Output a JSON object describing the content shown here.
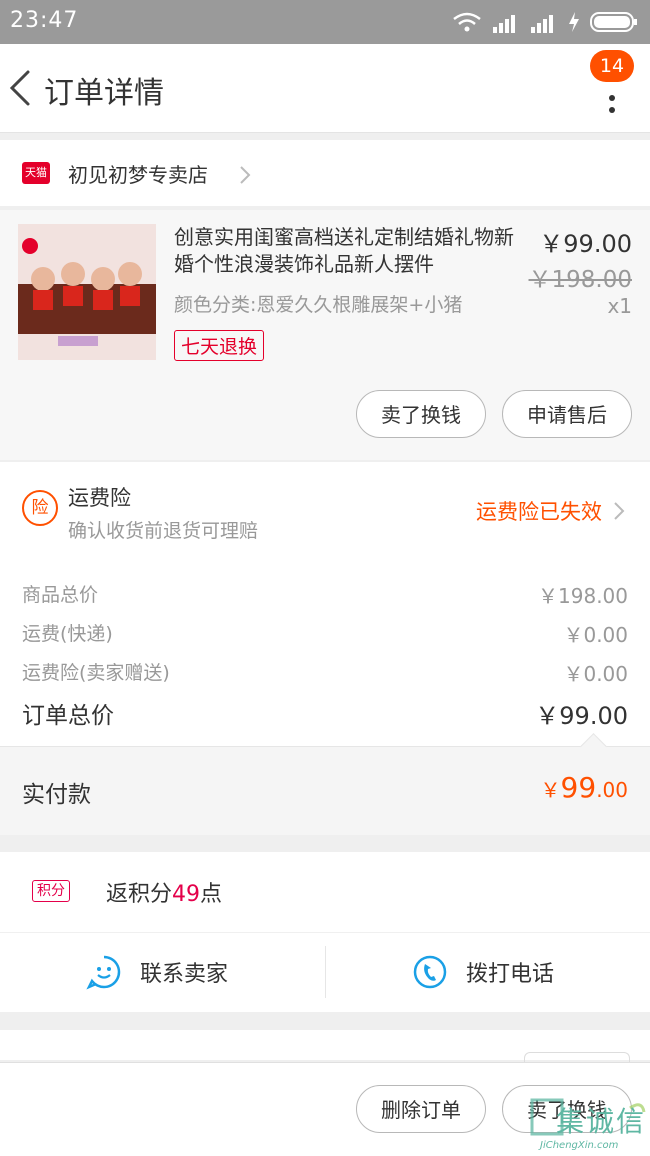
{
  "status_bar": {
    "time": "23:47"
  },
  "nav": {
    "title": "订单详情",
    "badge": "14"
  },
  "shop": {
    "tag": "天猫",
    "name": "初见初梦专卖店"
  },
  "product": {
    "title": "创意实用闺蜜高档送礼定制结婚礼物新婚个性浪漫装饰礼品新人摆件",
    "sku": "颜色分类:恩爱久久根雕展架+小猪",
    "tag": "七天退换",
    "price": "￥99.00",
    "original_price": "￥198.00",
    "quantity": "x1",
    "buttons": {
      "sell": "卖了换钱",
      "after_sale": "申请售后"
    }
  },
  "insurance": {
    "icon_text": "险",
    "title": "运费险",
    "subtitle": "确认收货前退货可理赔",
    "status": "运费险已失效"
  },
  "summary": {
    "rows": [
      {
        "label": "商品总价",
        "value": "￥198.00"
      },
      {
        "label": "运费(快递)",
        "value": "￥0.00"
      },
      {
        "label": "运费险(卖家赠送)",
        "value": "￥0.00"
      }
    ],
    "total_label": "订单总价",
    "total_value": "￥99.00",
    "paid_label": "实付款",
    "paid_yen": "￥",
    "paid_int": "99",
    "paid_dec": ".00"
  },
  "points": {
    "tag": "积分",
    "text_prefix": "返积分",
    "value": "49",
    "text_suffix": "点"
  },
  "actions": {
    "contact": "联系卖家",
    "call": "拨打电话"
  },
  "bottom": {
    "delete": "删除订单",
    "sell": "卖了换钱"
  },
  "watermark": {
    "text": "集诚信",
    "sub": "JiChengXin.com"
  },
  "colors": {
    "accent": "#ff5000",
    "tmall": "#e4002b",
    "points": "#e4004a",
    "blue": "#1aa0e6"
  },
  "icons": [
    "back-arrow-icon",
    "more-vertical-icon",
    "chevron-right-icon",
    "chat-face-icon",
    "phone-icon",
    "wifi-icon",
    "signal-icon",
    "battery-icon"
  ]
}
